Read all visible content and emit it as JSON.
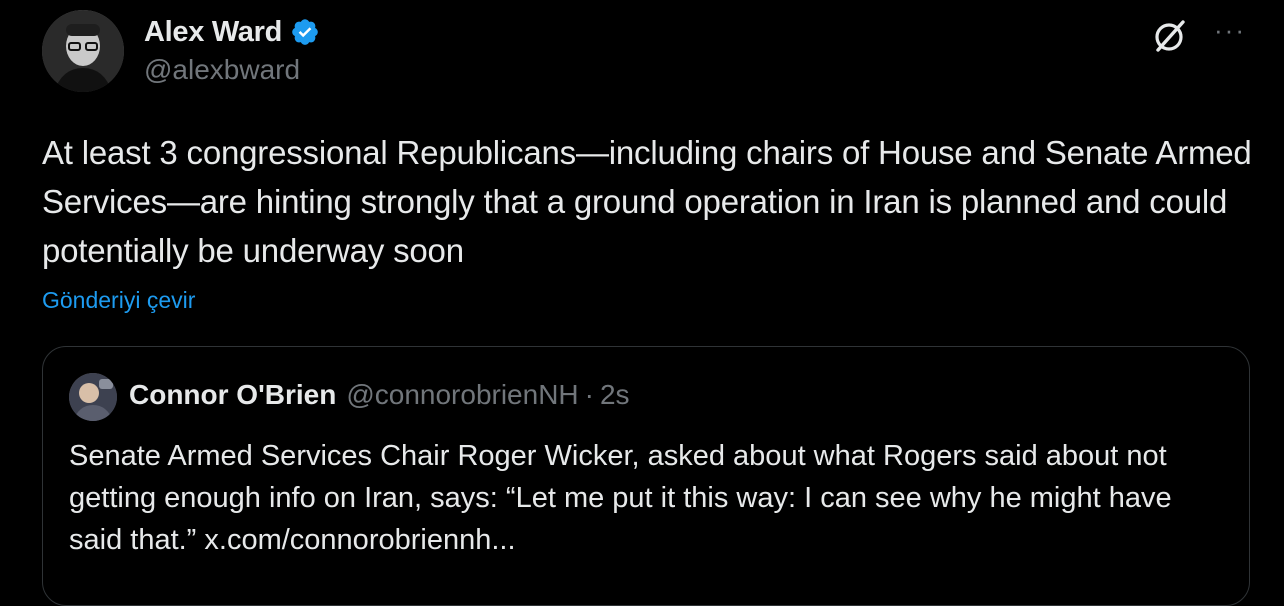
{
  "author": {
    "display_name": "Alex Ward",
    "handle": "@alexbward",
    "verified": true,
    "avatar_icon": "profile-photo"
  },
  "actions": {
    "grok_icon": "grok-icon",
    "more_icon": "more-icon",
    "more_label": "···"
  },
  "tweet": {
    "text": "At least 3 congressional Republicans—including chairs of House and Senate Armed Services—are hinting strongly that a ground operation in Iran is planned and could potentially be underway soon",
    "translate_label": "Gönderiyi çevir"
  },
  "quote": {
    "display_name": "Connor O'Brien",
    "handle": "@connorobrienNH",
    "separator": "·",
    "time": "2s",
    "text": "Senate Armed Services Chair Roger Wicker, asked about what Rogers said about not getting enough info on Iran, says: “Let me put it this way: I can see why he might have said that.” x.com/connorobriennh..."
  },
  "colors": {
    "background": "#000000",
    "text_primary": "#e7e9ea",
    "text_secondary": "#71767b",
    "accent": "#1d9bf0",
    "border": "#2f3336"
  }
}
